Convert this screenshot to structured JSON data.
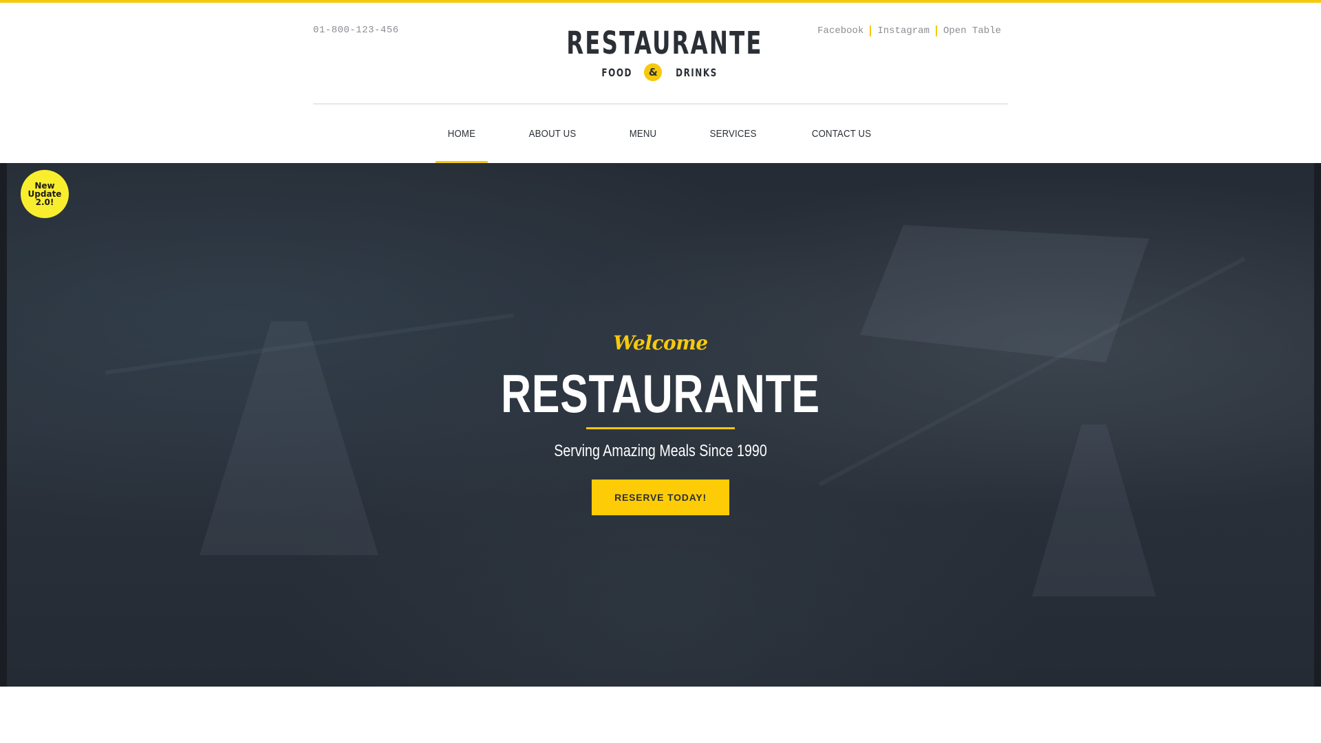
{
  "header": {
    "phone": "01-800-123-456",
    "social_links": [
      "Facebook",
      "Instagram",
      "Open Table"
    ],
    "logo": {
      "title": "RESTAURANTE",
      "sub_left": "FOOD",
      "sub_amp": "&",
      "sub_right": "DRINKS"
    }
  },
  "nav": {
    "items": [
      "HOME",
      "ABOUT US",
      "MENU",
      "SERVICES",
      "CONTACT US"
    ],
    "active": "HOME"
  },
  "badge": {
    "line1": "New",
    "line2": "Update",
    "line3": "2.0!"
  },
  "hero": {
    "welcome": "Welcome",
    "title": "RESTAURANTE",
    "subtitle": "Serving Amazing Meals Since 1990",
    "button": "RESERVE TODAY!"
  },
  "colors": {
    "accent": "#f6c90e",
    "button": "#fecc06",
    "badge": "#f9ee2e",
    "text_dark": "#2b2f36",
    "hero_bg": "#262c35"
  }
}
